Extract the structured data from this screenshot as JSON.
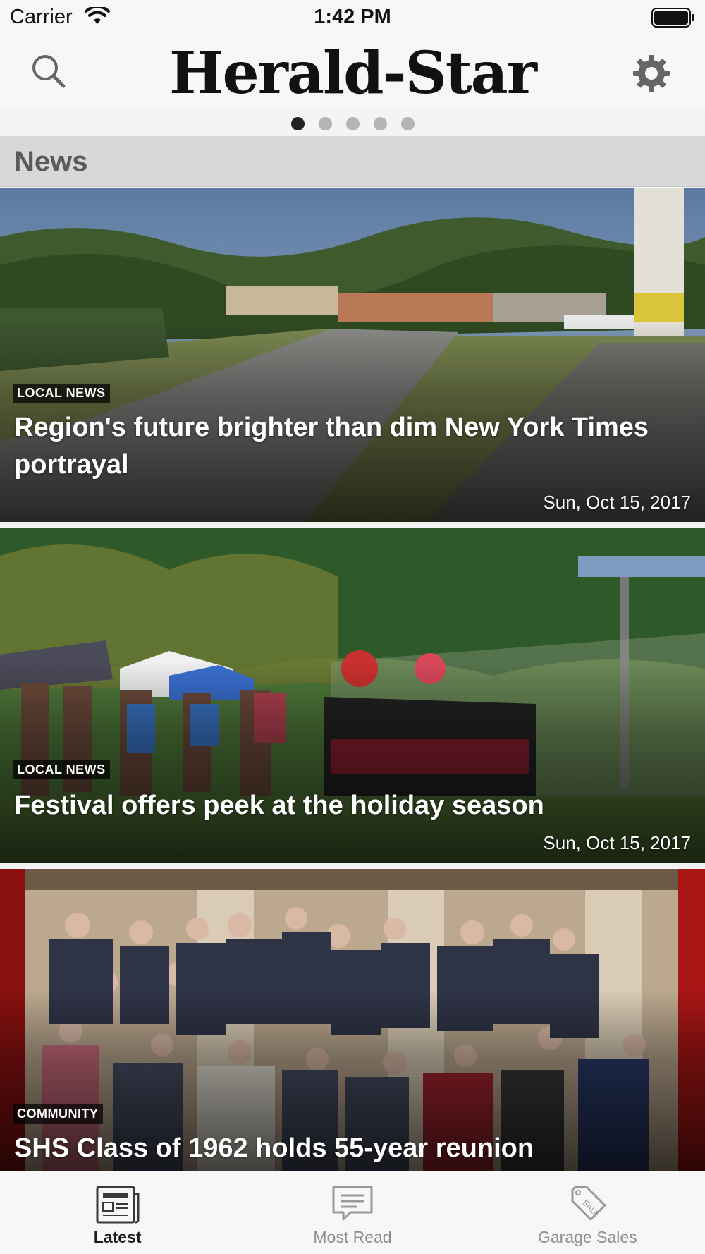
{
  "status_bar": {
    "carrier": "Carrier",
    "time": "1:42 PM"
  },
  "header": {
    "title": "Herald-Star",
    "search_icon": "search-icon",
    "settings_icon": "gear-icon"
  },
  "pager": {
    "count": 5,
    "active_index": 0
  },
  "section": {
    "title": "News"
  },
  "articles": [
    {
      "category": "LOCAL NEWS",
      "title": "Region's future brighter than dim New York Times portrayal",
      "date": "Sun, Oct 15, 2017"
    },
    {
      "category": "LOCAL NEWS",
      "title": "Festival offers peek  at the holiday season",
      "date": "Sun, Oct 15, 2017"
    },
    {
      "category": "COMMUNITY",
      "title": "SHS Class of 1962 holds 55-year reunion"
    }
  ],
  "tabs": [
    {
      "label": "Latest",
      "icon": "newspaper-icon",
      "active": true
    },
    {
      "label": "Most Read",
      "icon": "message-icon",
      "active": false
    },
    {
      "label": "Garage Sales",
      "icon": "sale-tag-icon",
      "active": false
    }
  ],
  "colors": {
    "accent": "#1c1c1c",
    "inactive": "#8e8e8e",
    "section_bg": "#d8d8d8"
  }
}
